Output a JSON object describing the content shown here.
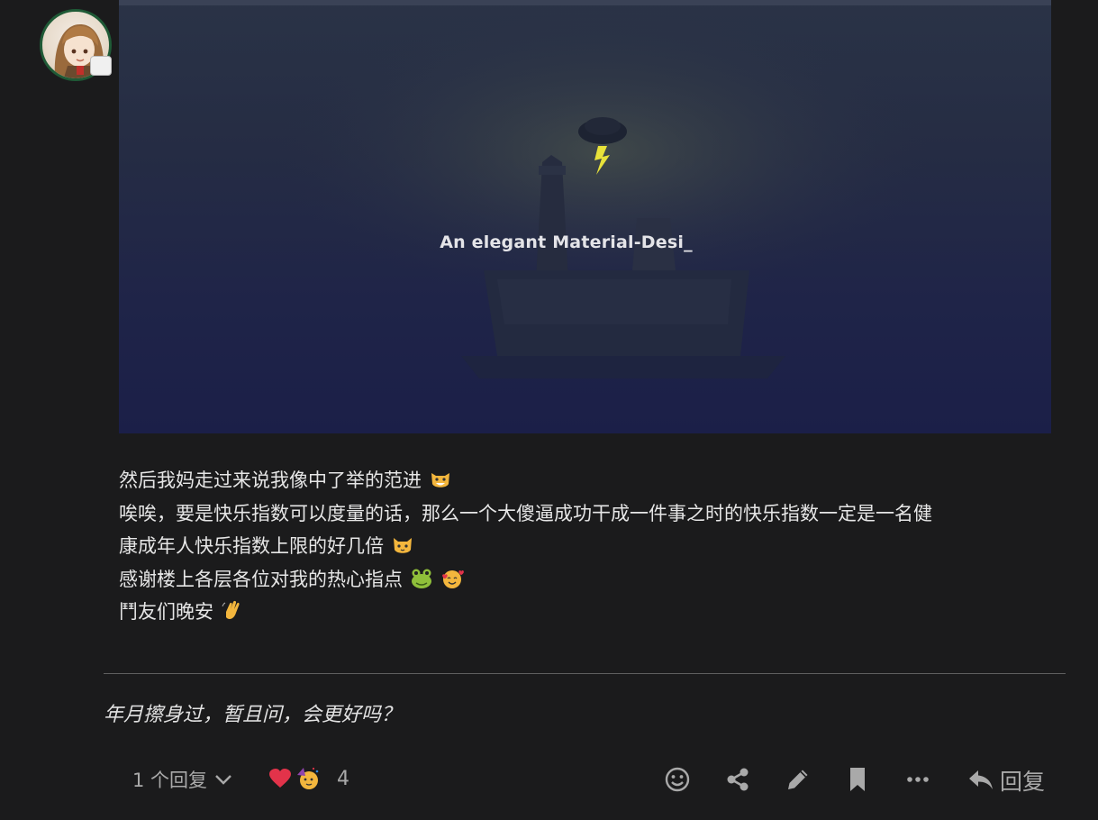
{
  "post": {
    "image": {
      "caption": "An elegant Material-Desi_"
    },
    "paragraphs": [
      {
        "text": "然后我妈走过来说我像中了举的范进",
        "emoji": [
          "grinning-cat-emoji"
        ]
      },
      {
        "text": "唉唉，要是快乐指数可以度量的话，那么一个大傻逼成功干成一件事之时的快乐指数一定是一名健",
        "emoji": []
      },
      {
        "text": "康成年人快乐指数上限的好几倍",
        "emoji": [
          "cat-face-emoji"
        ]
      },
      {
        "text": "感谢楼上各层各位对我的热心指点",
        "emoji": [
          "frog-emoji",
          "smiling-face-with-hearts-emoji"
        ]
      },
      {
        "text": "鬥友们晚安",
        "emoji": [
          "waving-hand-emoji"
        ]
      }
    ],
    "signature": "年月擦身过，暂且问，会更好吗？"
  },
  "controls": {
    "replies_label": "1 个回复",
    "reactions": [
      "red-heart-emoji",
      "partying-face-emoji"
    ],
    "reaction_count": "4",
    "reply_label": "回复",
    "actions": [
      "emoji-react-icon",
      "share-icon",
      "edit-icon",
      "bookmark-icon",
      "more-icon"
    ]
  },
  "colors": {
    "background": "#1b1b1c",
    "text": "#e6e6e6",
    "muted": "#a9a9a9",
    "avatar_ring": "#1f5a36"
  }
}
